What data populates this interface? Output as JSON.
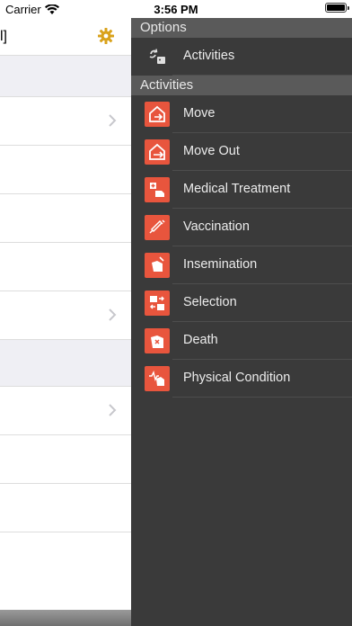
{
  "status_bar": {
    "carrier": "Carrier",
    "time": "3:56 PM"
  },
  "main": {
    "header_title_fragment": "l]",
    "icons": {
      "settings": "gear-icon",
      "chevron": "chevron-right-icon"
    }
  },
  "drawer": {
    "options_header": "Options",
    "options_items": [
      {
        "label": "Activities",
        "icon": "activities-icon"
      }
    ],
    "activities_header": "Activities",
    "activities_items": [
      {
        "label": "Move",
        "icon": "move-icon"
      },
      {
        "label": "Move Out",
        "icon": "move-out-icon"
      },
      {
        "label": "Medical Treatment",
        "icon": "medical-treatment-icon"
      },
      {
        "label": "Vaccination",
        "icon": "vaccination-icon"
      },
      {
        "label": "Insemination",
        "icon": "insemination-icon"
      },
      {
        "label": "Selection",
        "icon": "selection-icon"
      },
      {
        "label": "Death",
        "icon": "death-icon"
      },
      {
        "label": "Physical Condition",
        "icon": "physical-condition-icon"
      }
    ]
  },
  "colors": {
    "accent": "#e8553d",
    "gear": "#d9a21b",
    "drawer_bg": "#3a3a3a",
    "drawer_header_bg": "#5a5a5a"
  }
}
